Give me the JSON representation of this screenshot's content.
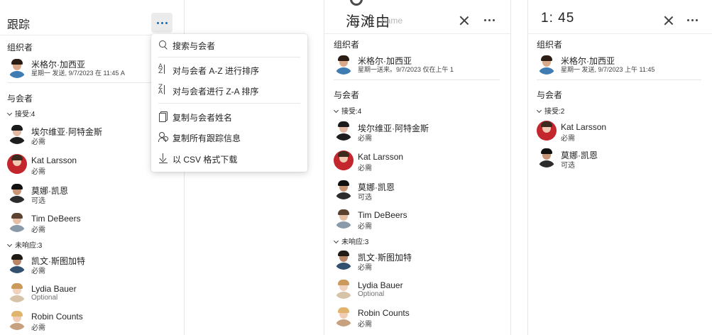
{
  "panel1": {
    "title": "跟踪",
    "organizer_label": "组织者",
    "organizer": {
      "name": "米格尔·加西亚",
      "detail": "星期一 发送, 9/7/2023 在 11:45 A"
    },
    "attendees_label": "与会者",
    "accepted_group": "接受:4",
    "unanswered_group": "未响应:3",
    "accepted": [
      {
        "name": "埃尔维亚·阿特金斯",
        "status": "必需"
      },
      {
        "name": "Kat Larsson",
        "status": "必需"
      },
      {
        "name": "莫娜·凯恩",
        "status": "可选"
      },
      {
        "name": "Tim DeBeers",
        "status": "必需"
      }
    ],
    "unanswered": [
      {
        "name": "凯文·斯图加特",
        "status": "必需"
      },
      {
        "name": "Lydia Bauer",
        "status": "Optional"
      },
      {
        "name": "Robin Counts",
        "status": "必需"
      }
    ]
  },
  "menu": {
    "items": [
      {
        "label": "搜索与会者",
        "icon": "search-icon"
      },
      {
        "label": "对与会者 A-Z 进行排序",
        "icon": "sort-az-icon"
      },
      {
        "label": "对与会者进行 Z-A 排序",
        "icon": "sort-za-icon"
      },
      {
        "label": "复制与会者姓名",
        "icon": "copy-icon"
      },
      {
        "label": "复制所有跟踪信息",
        "icon": "people-copy-icon"
      },
      {
        "label": "以 CSV 格式下载",
        "icon": "download-icon"
      }
    ]
  },
  "panel2": {
    "title": "海滩由",
    "title_ghost": "name",
    "organizer_label": "组织者",
    "organizer": {
      "name": "米格尔·加西亚",
      "detail": "星期一送来。9/7/2023 仅在上午 1"
    },
    "attendees_label": "与会者",
    "accepted_group": "接受:4",
    "unanswered_group": "未响应:3",
    "accepted": [
      {
        "name": "埃尔维亚·阿特金斯",
        "status": "必需"
      },
      {
        "name": "Kat Larsson",
        "status": "必需"
      },
      {
        "name": "莫娜·凯恩",
        "status": "可选"
      },
      {
        "name": "Tim DeBeers",
        "status": "必需"
      }
    ],
    "unanswered": [
      {
        "name": "凯文·斯图加特",
        "status": "必需"
      },
      {
        "name": "Lydia Bauer",
        "status": "Optional"
      },
      {
        "name": "Robin Counts",
        "status": "必需"
      }
    ]
  },
  "panel3": {
    "title": "1: 45",
    "organizer_label": "组织者",
    "organizer": {
      "name": "米格尔·加西亚",
      "detail": "星期一 发送, 9/7/2023 上午 11:45"
    },
    "attendees_label": "与会者",
    "accepted_group": "接受:2",
    "accepted": [
      {
        "name": "Kat Larsson",
        "status": "必需"
      },
      {
        "name": "莫娜·凯恩",
        "status": "可选"
      }
    ]
  },
  "colors": {
    "accent": "#0f6cbd",
    "text": "#242424",
    "divider": "#e6e6e6"
  }
}
